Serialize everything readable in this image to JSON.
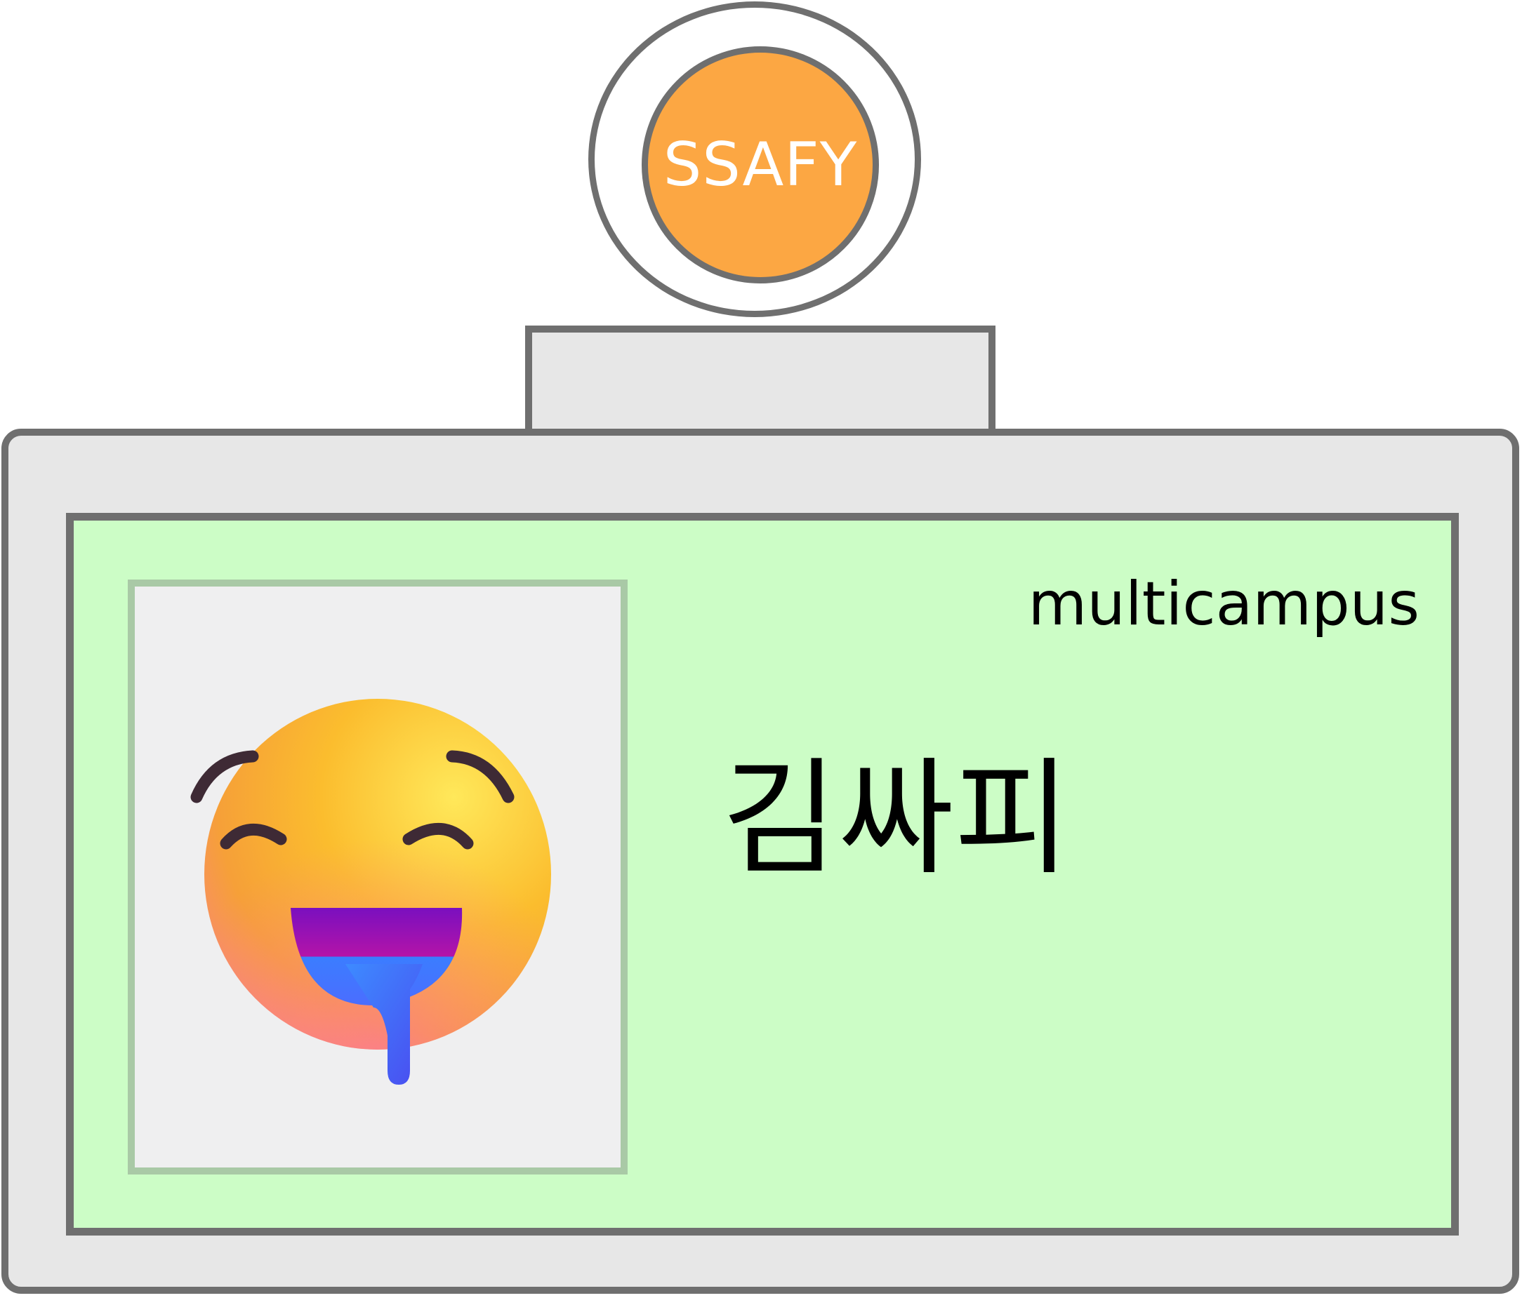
{
  "badge": {
    "logo_text": "SSAFY",
    "organization": "multicampus",
    "name": "김싸피",
    "photo_icon": "drooling-face-emoji"
  },
  "colors": {
    "logo_fill": "#fca743",
    "outline": "#6f6f6f",
    "card_fill": "#e7e7e7",
    "panel_fill": "#ccfdc6",
    "photo_border": "#a9c9a6",
    "photo_fill": "#efeff0"
  }
}
